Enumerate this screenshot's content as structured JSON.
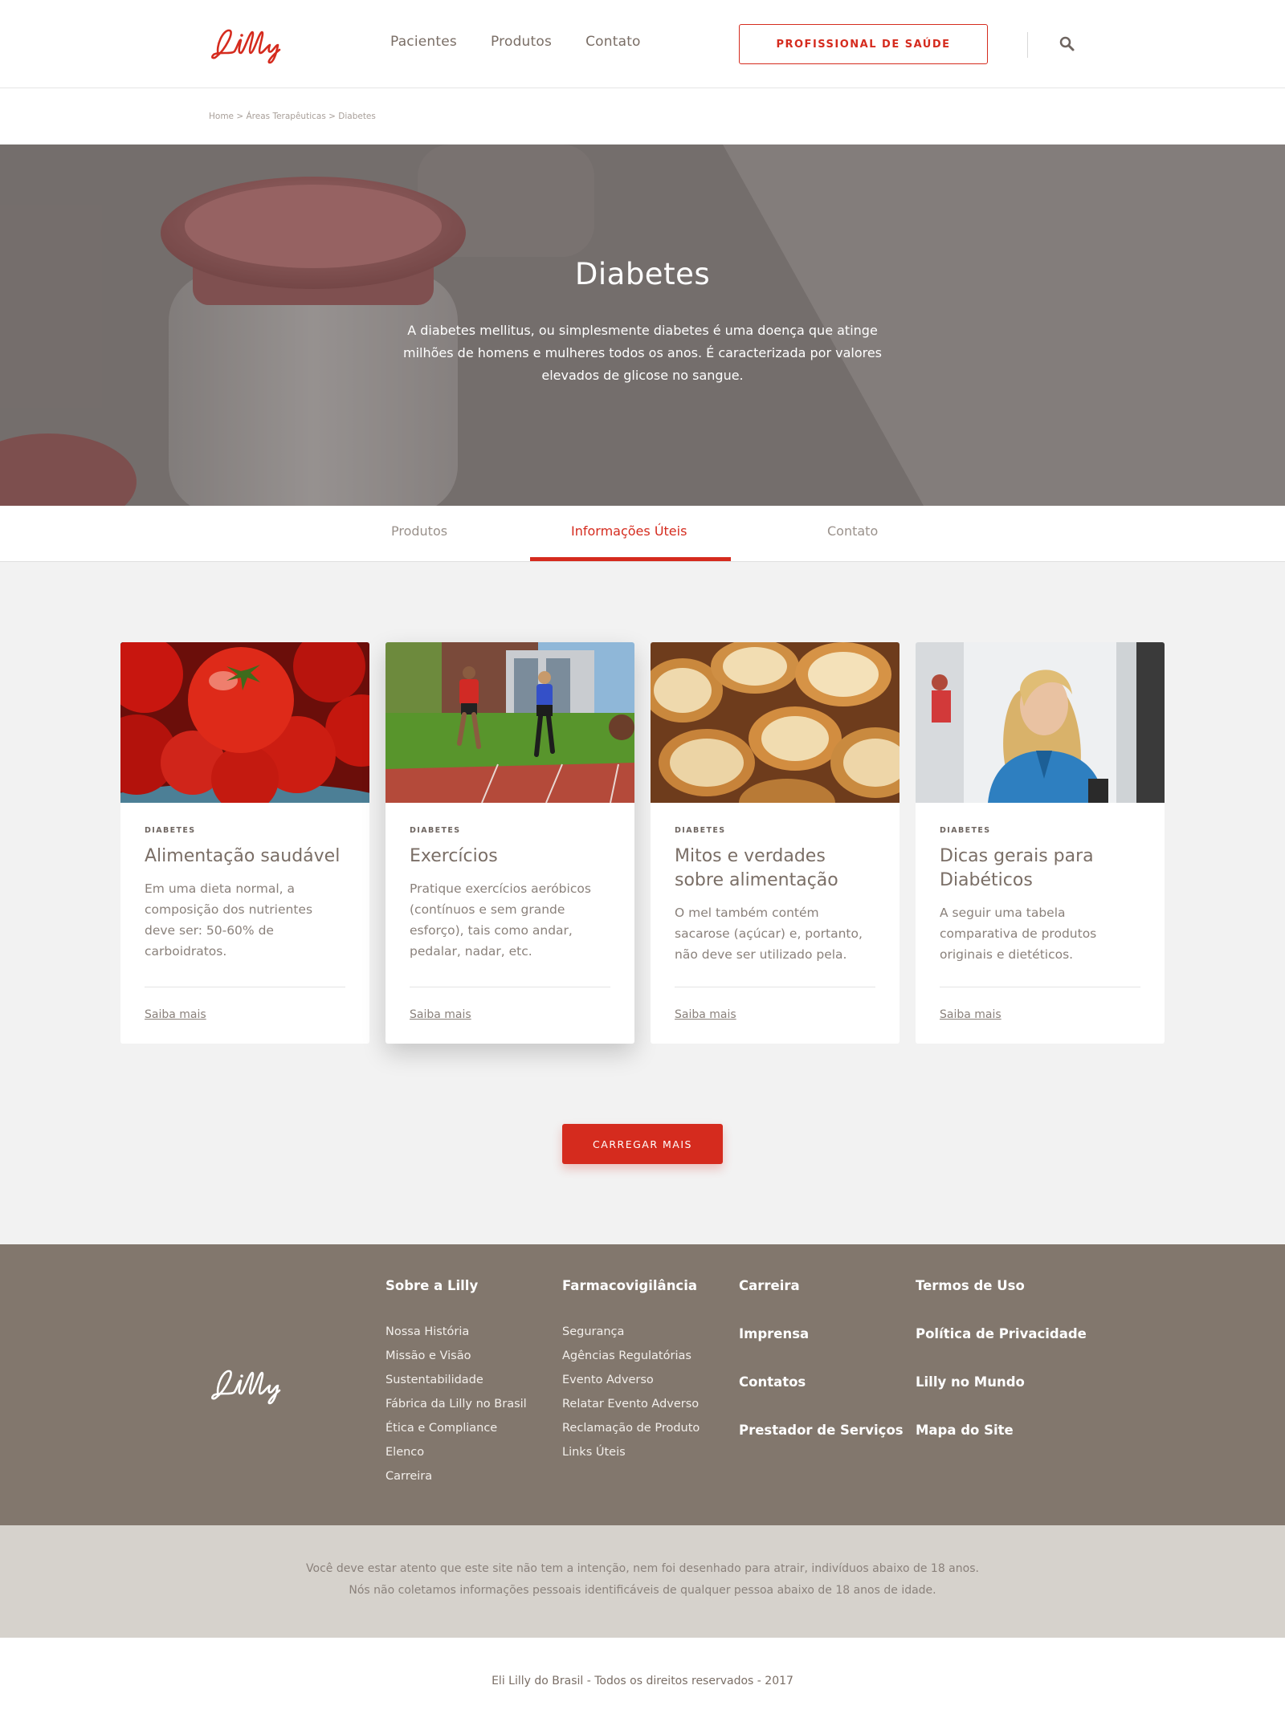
{
  "brand": {
    "logo_text": "Lilly",
    "accent_color": "#d52b1e"
  },
  "header": {
    "nav": [
      "Pacientes",
      "Produtos",
      "Contato"
    ],
    "pro_button": "PROFISSIONAL DE SAÚDE",
    "search_icon": "search-icon"
  },
  "breadcrumb": "Home > Áreas Terapêuticas > Diabetes",
  "hero": {
    "title": "Diabetes",
    "description": "A diabetes mellitus, ou simplesmente diabetes é uma doença que atinge milhões de homens e mulheres todos os anos. É caracterizada por valores elevados de glicose no sangue."
  },
  "tabs": [
    {
      "label": "Produtos",
      "active": false
    },
    {
      "label": "Informações Úteis",
      "active": true
    },
    {
      "label": "Contato",
      "active": false
    }
  ],
  "cards": [
    {
      "category": "DIABETES",
      "title": "Alimentação saudável",
      "desc": "Em uma dieta normal, a composição dos nutrientes deve ser: 50-60% de carboidratos.",
      "link": "Saiba mais"
    },
    {
      "category": "DIABETES",
      "title": "Exercícios",
      "desc": "Pratique exercícios aeróbicos (contínuos e sem grande esforço), tais como andar, pedalar, nadar, etc.",
      "link": "Saiba mais"
    },
    {
      "category": "DIABETES",
      "title": "Mitos e verdades sobre alimentação",
      "desc": "O mel também contém sacarose (açúcar) e, portanto, não deve ser utilizado pela.",
      "link": "Saiba mais"
    },
    {
      "category": "DIABETES",
      "title": "Dicas gerais para Diabéticos",
      "desc": "A seguir uma tabela comparativa de produtos originais e dietéticos.",
      "link": "Saiba mais"
    }
  ],
  "load_more": "CARREGAR MAIS",
  "footer": {
    "col1": {
      "title": "Sobre a Lilly",
      "items": [
        "Nossa História",
        "Missão e Visão",
        "Sustentabilidade",
        "Fábrica da Lilly no Brasil",
        "Ética e Compliance",
        "Elenco",
        "Carreira"
      ]
    },
    "col2": {
      "title": "Farmacovigilância",
      "items": [
        "Segurança",
        "Agências Regulatórias",
        "Evento Adverso",
        "Relatar Evento Adverso",
        "Reclamação de Produto",
        "Links Úteis"
      ]
    },
    "col3": [
      "Carreira",
      "Imprensa",
      "Contatos",
      "Prestador de Serviços"
    ],
    "col4": [
      "Termos de Uso",
      "Política de Privacidade",
      "Lilly no Mundo",
      "Mapa do Site"
    ]
  },
  "notice": {
    "line1": "Você deve estar atento que este site não tem a intenção, nem foi desenhado para atrair, indivíduos abaixo de 18 anos.",
    "line2": "Nós não coletamos informações pessoais identificáveis de qualquer pessoa abaixo de 18 anos de idade."
  },
  "copyright": "Eli Lilly do Brasil - Todos os direitos reservados - 2017"
}
